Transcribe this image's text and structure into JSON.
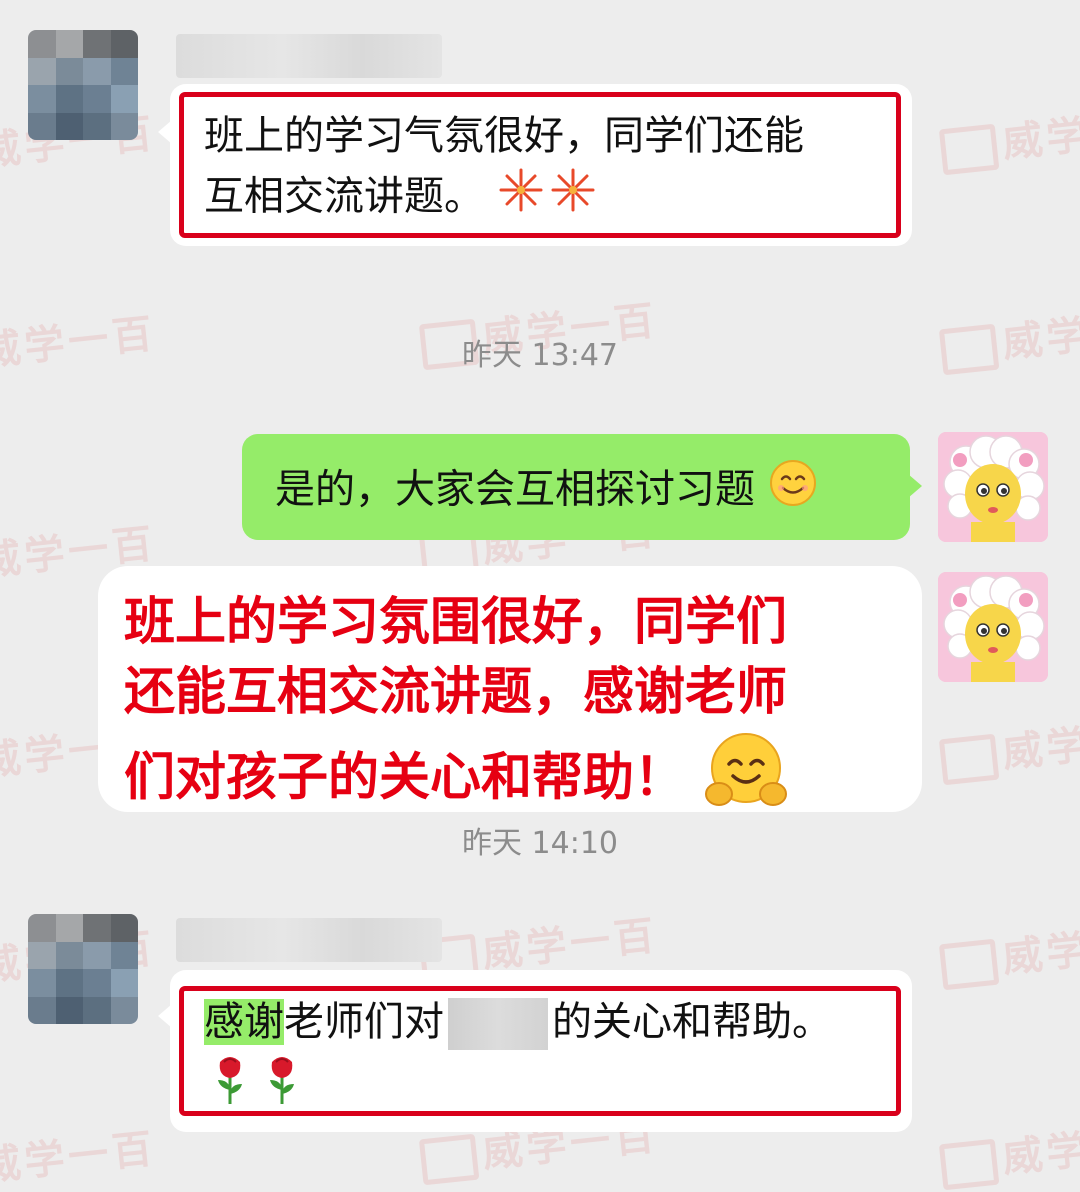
{
  "messages": {
    "m1": {
      "line1": "班上的学习气氛很好，同学们还能",
      "line2": "互相交流讲题。",
      "emoji": "firework-icon"
    },
    "ts1": "昨天 13:47",
    "m2": {
      "text": "是的，大家会互相探讨习题",
      "emoji": "smile-icon"
    },
    "m3": {
      "line1": "班上的学习氛围很好，同学们",
      "line2": "还能互相交流讲题，感谢老师",
      "line3": "们对孩子的关心和帮助！",
      "emoji": "hug-icon"
    },
    "ts2": "昨天 14:10",
    "m4": {
      "highlight": "感谢",
      "part1": "老师们对",
      "part2": "的关心和帮助。",
      "emoji": "rose-icon"
    }
  },
  "watermark": "威学一百",
  "colors": {
    "background": "#ededed",
    "green_bubble": "#95ec69",
    "highlight_box": "#d9001b",
    "red_text": "#e60012",
    "timestamp": "#8c8c8c"
  }
}
